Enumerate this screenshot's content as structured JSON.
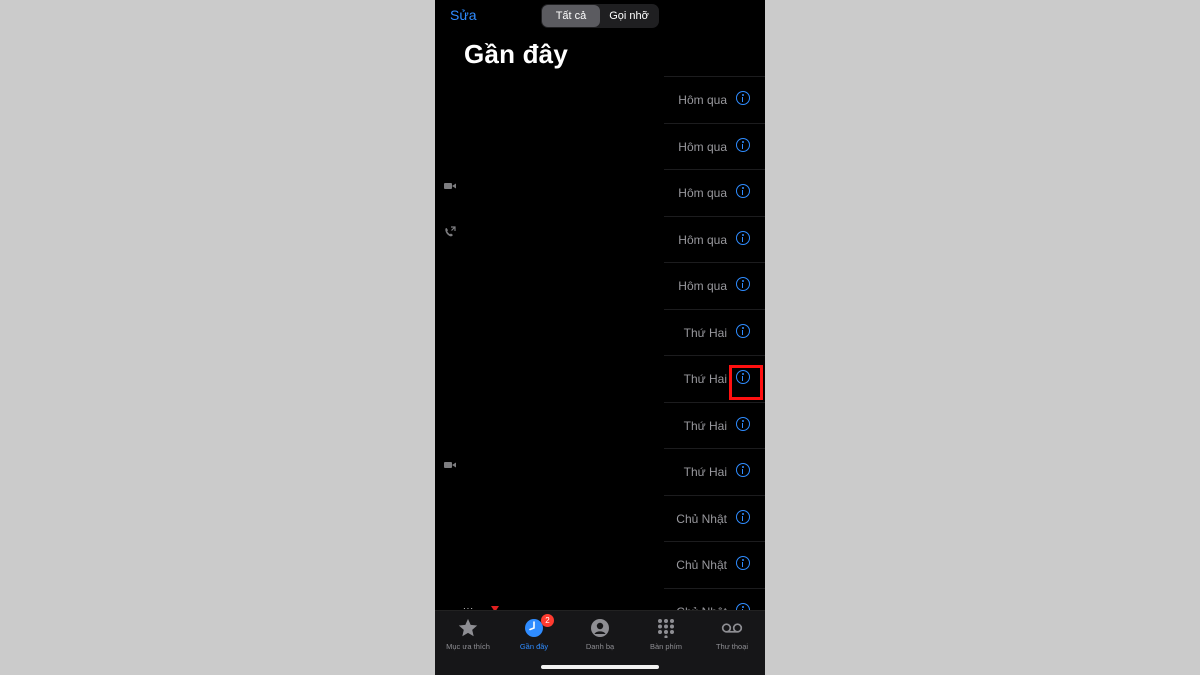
{
  "header": {
    "edit_label": "Sửa",
    "segments": [
      {
        "label": "Tất cả",
        "active": true
      },
      {
        "label": "Gọi nhỡ",
        "active": false
      }
    ],
    "title": "Gần đây"
  },
  "recents": [
    {
      "date": "Hôm qua"
    },
    {
      "date": "Hôm qua"
    },
    {
      "date": "Hôm qua"
    },
    {
      "date": "Hôm qua"
    },
    {
      "date": "Hôm qua"
    },
    {
      "date": "Thứ Hai"
    },
    {
      "date": "Thứ Hai"
    },
    {
      "date": "Thứ Hai"
    },
    {
      "date": "Thứ Hai"
    },
    {
      "date": "Chủ Nhật"
    },
    {
      "date": "Chủ Nhật"
    },
    {
      "date": "Chủ Nhật"
    }
  ],
  "tab_bar": {
    "items": [
      {
        "label": "Mục ưa thích",
        "icon": "star-icon"
      },
      {
        "label": "Gần đây",
        "icon": "clock-icon",
        "badge": "2",
        "active": true
      },
      {
        "label": "Danh bạ",
        "icon": "person-icon"
      },
      {
        "label": "Bàn phím",
        "icon": "keypad-icon"
      },
      {
        "label": "Thư thoại",
        "icon": "voicemail-icon"
      }
    ]
  },
  "colors": {
    "accent": "#2f8cff",
    "highlight": "#ff1010",
    "badge": "#ff3b30"
  }
}
